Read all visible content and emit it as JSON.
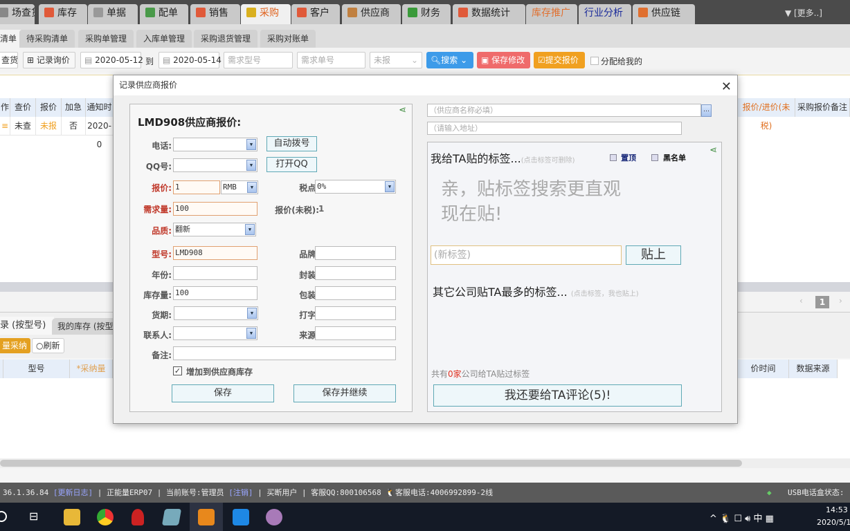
{
  "top_tabs": [
    {
      "label": "场查货",
      "icon": "search-icon",
      "color": "#888"
    },
    {
      "label": "库存",
      "icon": "home-icon",
      "color": "#e05a3a"
    },
    {
      "label": "单据",
      "icon": "document-icon",
      "color": "#999"
    },
    {
      "label": "配单",
      "icon": "spreadsheet-icon",
      "color": "#4a9a4a"
    },
    {
      "label": "销售",
      "icon": "bar-chart-icon",
      "color": "#e05a3a"
    },
    {
      "label": "采购",
      "icon": "basket-icon",
      "color": "#d9b020",
      "active": true
    },
    {
      "label": "客户",
      "icon": "user-icon",
      "color": "#e05a3a"
    },
    {
      "label": "供应商",
      "icon": "users-icon",
      "color": "#c08040"
    },
    {
      "label": "财务",
      "icon": "dollar-icon",
      "color": "#3a9a3a"
    },
    {
      "label": "数据统计",
      "icon": "stats-icon",
      "color": "#e05a3a"
    },
    {
      "label": "库存推广",
      "color": "#e07030"
    },
    {
      "label": "行业分析",
      "color": "#1a2a9a"
    },
    {
      "label": "供应链",
      "icon": "truck-icon",
      "color": "#e07030"
    }
  ],
  "more_label": "▼ [更多..]",
  "sub_tabs": [
    "清单",
    "待采购清单",
    "采购单管理",
    "入库单管理",
    "采购退货管理",
    "采购对账单"
  ],
  "toolbar": {
    "find_stock": "查货",
    "record_inquiry": "记录询价",
    "date_from": "2020-05-12",
    "to_label": "到",
    "date_to": "2020-05-14",
    "model_placeholder": "需求型号",
    "order_placeholder": "需求单号",
    "status_select": "未报",
    "search": "搜索",
    "save_changes": "保存修改",
    "submit_quote": "提交报价",
    "assigned_to_me": "分配给我的"
  },
  "grid": {
    "headers": [
      "作",
      "查价",
      "报价",
      "加急",
      "通知时"
    ],
    "row": [
      "",
      "未查",
      "未报",
      "否",
      "2020-0"
    ],
    "right_headers": [
      "报价/进价(未税)",
      "采购报价备注"
    ]
  },
  "pager": {
    "page": "1"
  },
  "bottom": {
    "tabs": [
      "录 (按型号)",
      "我的库存 (按型号)"
    ],
    "batch_accept": "量采纳",
    "refresh": "刷新",
    "headers": [
      "型号",
      "*采纳量"
    ],
    "right_headers": [
      "价时间",
      "数据来源"
    ]
  },
  "status_bar": {
    "version": "36.1.36.84",
    "changelog": "[更新日志]",
    "company": "正能量ERP07",
    "account_label": "当前账号:",
    "account": "管理员",
    "logout": "[注销]",
    "user_type": "买断用户",
    "qq_label": "客服QQ:",
    "qq": "800106568",
    "phone_label": "客服电话:",
    "phone": "4006992899-2线",
    "usb": "USB电话盒状态:"
  },
  "taskbar": {
    "time": "14:53",
    "date": "2020/5/1",
    "ime": "中"
  },
  "dialog": {
    "title": "记录供应商报价",
    "heading": "LMD908供应商报价:",
    "phone_label": "电话:",
    "phone": "",
    "auto_dial": "自动拨号",
    "qq_label": "QQ号:",
    "qq": "",
    "open_qq": "打开QQ",
    "price_label": "报价:",
    "price": "1",
    "currency": "RMB",
    "tax_label": "税点:",
    "tax": "0%",
    "qty_label": "需求量:",
    "qty": "100",
    "pre_tax_label": "报价(未税):",
    "pre_tax": "1",
    "quality_label": "品质:",
    "quality": "翻新",
    "model_label": "型号:",
    "model": "LMD908",
    "brand_label": "品牌:",
    "brand": "",
    "year_label": "年份:",
    "package_label": "封装:",
    "stock_label": "库存量:",
    "stock": "100",
    "packing_label": "包装:",
    "lead_label": "货期:",
    "marking_label": "打字:",
    "contact_label": "联系人:",
    "source_label": "来源:",
    "note_label": "备注:",
    "add_stock": "增加到供应商库存",
    "add_stock_checked": true,
    "save": "保存",
    "save_continue": "保存并继续",
    "supplier_placeholder": "（供应商名称必填）",
    "address_placeholder": "（请输入地址）",
    "my_tags": "我给TA贴的标签...",
    "my_tags_hint": "(点击标签可删除)",
    "pin": "置顶",
    "blacklist": "黑名单",
    "promo_line1": "亲，贴标签搜索更直观",
    "promo_line2": "现在贴!",
    "new_tag_placeholder": "(新标签)",
    "apply_tag": "贴上",
    "others_tags": "其它公司贴TA最多的标签...",
    "others_hint": "(点击标签，我也贴上)",
    "count_prefix": "共有",
    "count": "0家",
    "count_suffix": "公司给TA贴过标签",
    "comment": "我还要给TA评论(5)!"
  }
}
